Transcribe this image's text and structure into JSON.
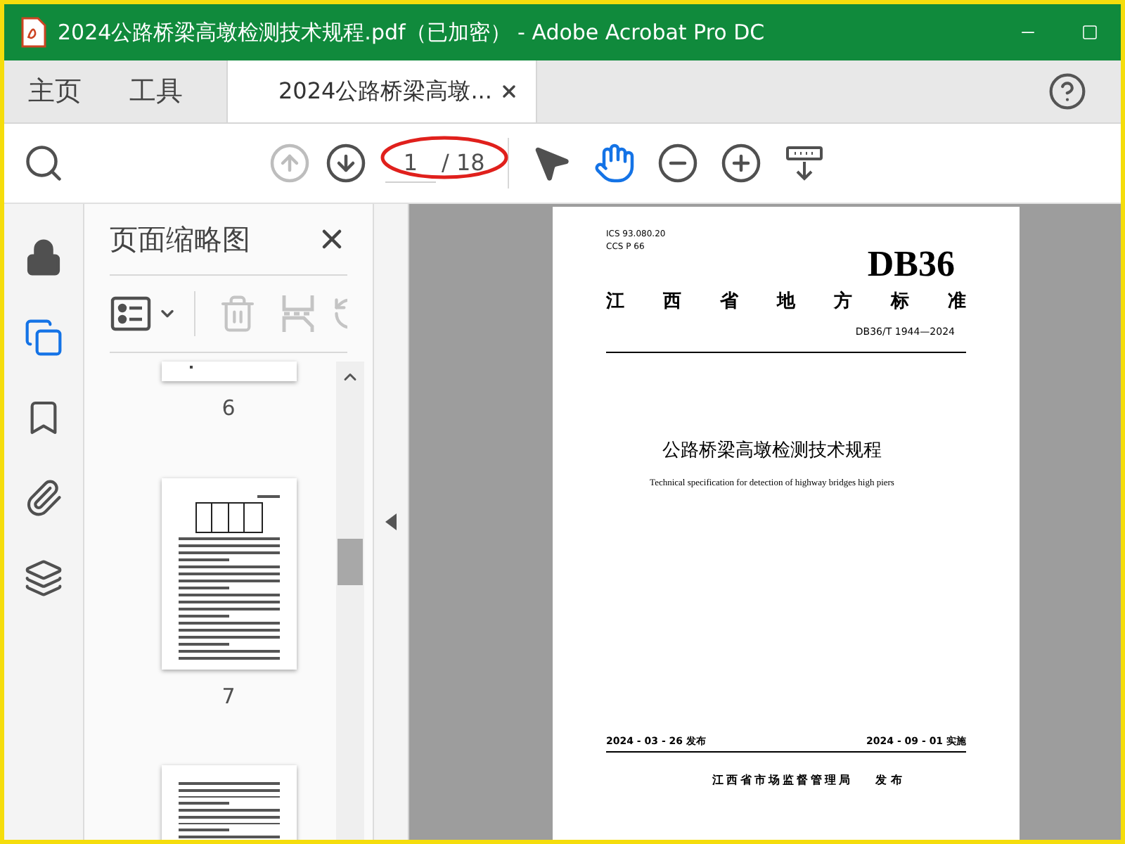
{
  "window": {
    "title": "2024公路桥梁高墩检测技术规程.pdf（已加密） - Adobe Acrobat Pro DC"
  },
  "tabs": [
    {
      "label": "主页",
      "kind": "menu",
      "selected": false
    },
    {
      "label": "工具",
      "kind": "menu",
      "selected": false
    },
    {
      "label": "2024公路桥梁高墩...",
      "kind": "document",
      "selected": true
    }
  ],
  "toolbar": {
    "buttons": [
      {
        "kind": "search",
        "disabled": false
      },
      {
        "kind": "previous",
        "disabled": true
      },
      {
        "kind": "next",
        "disabled": false
      },
      {
        "kind": "page"
      },
      {
        "kind": "select",
        "selected": false
      },
      {
        "kind": "hand",
        "selected": true
      },
      {
        "kind": "zoom_out",
        "disabled": false
      },
      {
        "kind": "zoom_in",
        "disabled": false
      },
      {
        "kind": "scroll_mode",
        "disabled": false
      }
    ],
    "page_field": {
      "value": "1",
      "total": "/ 18",
      "annotated": true
    }
  },
  "side_rail": [
    {
      "kind": "lock",
      "selected": false
    },
    {
      "kind": "pages",
      "selected": true
    },
    {
      "kind": "bookmark",
      "selected": false
    },
    {
      "kind": "attachment",
      "selected": false
    },
    {
      "kind": "layers",
      "selected": false
    }
  ],
  "thumbnail_panel": {
    "title": "页面缩略图",
    "tools": [
      {
        "kind": "options",
        "disabled": false
      },
      {
        "kind": "delete",
        "disabled": true
      },
      {
        "kind": "extract",
        "disabled": true
      },
      {
        "kind": "rotate",
        "disabled": true
      }
    ],
    "thumbnails": [
      {
        "label": "6",
        "kind": "tail"
      },
      {
        "label": "7",
        "kind": "table"
      },
      {
        "kind": "text"
      }
    ]
  },
  "document": {
    "ics": "ICS 93.080.20",
    "ccs": "CCS P 66",
    "code": "DB36",
    "category": "江西省地方标准",
    "number": "DB36/T 1944—2024",
    "title": "公路桥梁高墩检测技术规程",
    "subtitle": "Technical specification for detection of highway bridges high piers",
    "issue_date": "2024 - 03 - 26 发布",
    "effective_date": "2024 - 09 - 01 实施",
    "publisher": "江西省市场监督管理局",
    "publish_word": "发 布"
  }
}
